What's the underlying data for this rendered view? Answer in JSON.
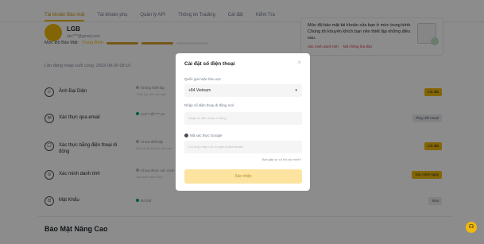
{
  "topnav": {
    "tabs": [
      "Tài khoản Bảo mật",
      "Tài khoản phụ",
      "Quản lý API",
      "Thông tin Trading",
      "Cài đặt",
      "Kiểm Tra"
    ]
  },
  "profile": {
    "name": "LGB",
    "email": "abc***@gmail.com"
  },
  "security": {
    "label": "Mức Độ Bảo Mật:",
    "level": "Trung Bình"
  },
  "last_login": "Lần đăng nhập cuối cùng: 2023-08-30 09:10",
  "alert": {
    "message": "Mức độ bảo mật tài khoản của bạn ở mức trung bình. Chúng tôi khuyến khích bạn nên thiết lập những điều sau.",
    "link1": "Xác minh danh tính",
    "link2": "Mã chống lừa đảo"
  },
  "rows": [
    {
      "title": "Ảnh Đại Diện",
      "status": "Không thiết lập",
      "sub": "Thiết lập ảnh đại diện",
      "btn": "Cài đặt",
      "dot": "#b7bdc6"
    },
    {
      "title": "Xác thực qua email",
      "status": "ceo***@****.vn",
      "sub": "",
      "btn": "Thay đổi email",
      "dot": "#03a66d"
    },
    {
      "title": "Xác thực bằng điện thoại di động",
      "status": "Chưa thiết lập",
      "sub": "Bảo vệ tài khoản của bạn",
      "btn": "Cài đặt",
      "dot": "#b7bdc6"
    },
    {
      "title": "Xác minh danh tính",
      "status": "Chưa được xác minh",
      "sub": "Xác minh danh tính",
      "btn": "Xác minh ngay",
      "dot": "#b7bdc6"
    },
    {
      "title": "Mật Khẩu",
      "status": "Đã bật",
      "sub": "",
      "btn": "Sửa",
      "dot": "#03a66d"
    }
  ],
  "advanced_title": "Bảo Mật Nâng Cao",
  "modal": {
    "title": "Cài đặt số điện thoại",
    "close": "×",
    "country_label": "Quốc gia hoặc khu vực",
    "country_value": "+84 Vietnam",
    "phone_label": "Nhập số điện thoại di động mới",
    "phone_placeholder": "Nhập số điện thoại di động",
    "google_label": "Mã xác thực Google",
    "google_placeholder": "Vui lòng nhập mã Google Authenticator",
    "help_link": "Bạn gặp sự cố khi xác minh?",
    "submit": "Xác nhận"
  },
  "chat_icon": "headset-icon"
}
